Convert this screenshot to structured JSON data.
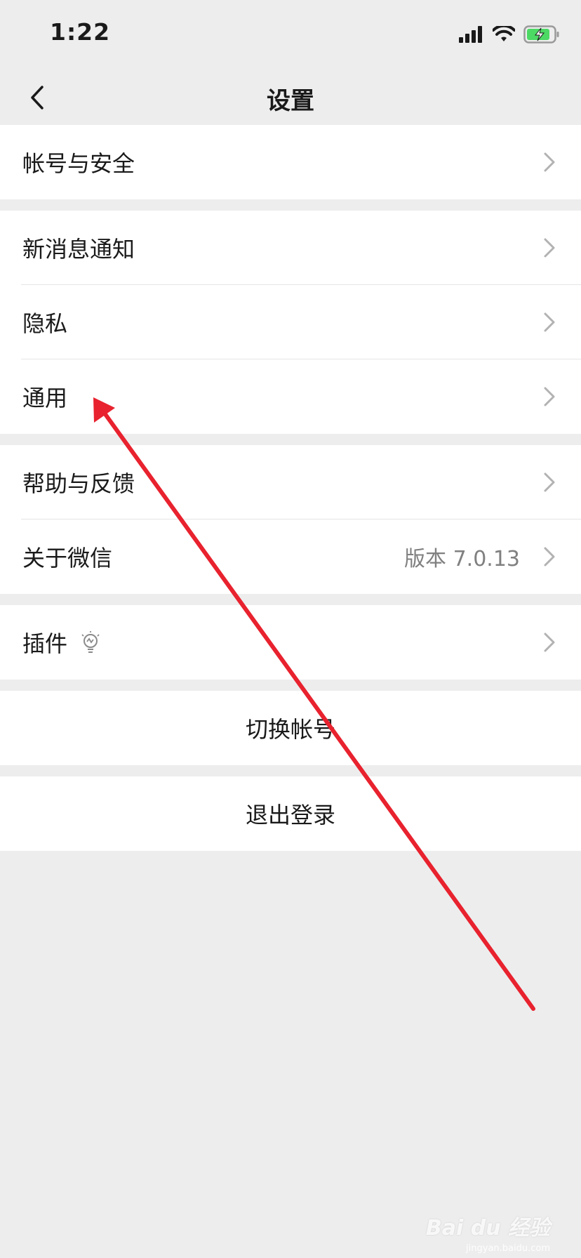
{
  "status_bar": {
    "time": "1:22",
    "icons": [
      "cellular-signal-icon",
      "wifi-icon",
      "battery-charging-icon"
    ]
  },
  "nav": {
    "title": "设置",
    "back_icon": "chevron-left-icon"
  },
  "sections": [
    {
      "items": [
        {
          "label": "帐号与安全"
        }
      ]
    },
    {
      "items": [
        {
          "label": "新消息通知"
        },
        {
          "label": "隐私"
        },
        {
          "label": "通用"
        }
      ]
    },
    {
      "items": [
        {
          "label": "帮助与反馈"
        },
        {
          "label": "关于微信",
          "value": "版本 7.0.13"
        }
      ]
    },
    {
      "items": [
        {
          "label": "插件",
          "icon": "lightbulb-icon"
        }
      ]
    }
  ],
  "actions": {
    "switch_account": "切换帐号",
    "logout": "退出登录"
  },
  "annotation": {
    "arrow_color": "#e8222e"
  },
  "watermark": {
    "brand": "Bai du 经验",
    "url": "jingyan.baidu.com"
  },
  "colors": {
    "background": "#ededed",
    "cell": "#ffffff",
    "battery_green": "#4cd964"
  }
}
